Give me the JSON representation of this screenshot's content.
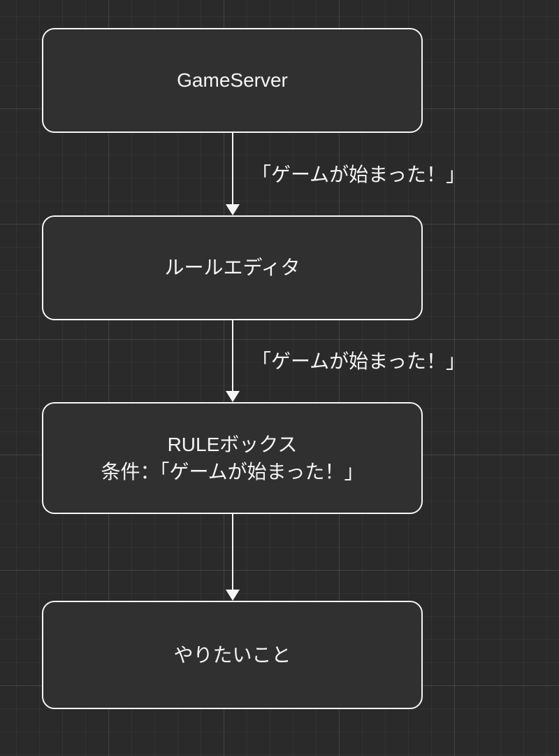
{
  "nodes": [
    {
      "id": "gameserver",
      "lines": [
        "GameServer"
      ]
    },
    {
      "id": "rule-editor",
      "lines": [
        "ルールエディタ"
      ]
    },
    {
      "id": "rule-box",
      "lines": [
        "RULEボックス",
        "条件：「ゲームが始まった！」"
      ]
    },
    {
      "id": "todo",
      "lines": [
        "やりたいこと"
      ]
    }
  ],
  "edges": [
    {
      "from": "gameserver",
      "to": "rule-editor",
      "label": "「ゲームが始まった！」"
    },
    {
      "from": "rule-editor",
      "to": "rule-box",
      "label": "「ゲームが始まった！」"
    },
    {
      "from": "rule-box",
      "to": "todo",
      "label": ""
    }
  ]
}
